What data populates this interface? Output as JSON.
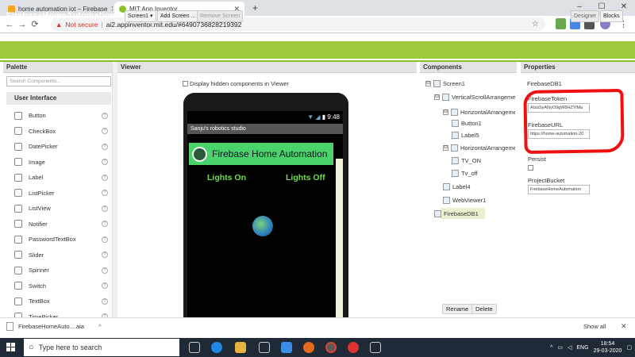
{
  "browser": {
    "tabs": [
      {
        "title": "home automation iot – Firebase",
        "active": false
      },
      {
        "title": "MIT App Inventor",
        "active": true
      }
    ],
    "new_tab": "+",
    "window_controls": {
      "minimize": "–",
      "maximize": "☐",
      "close": "✕"
    },
    "nav": {
      "back": "←",
      "forward": "→",
      "reload": "⟳"
    },
    "address": {
      "security": "Not secure",
      "separator": "|",
      "url": "ai2.appinventor.mit.edu/#6490736828219392"
    }
  },
  "app": {
    "project_name": "FirebaseHomeAutomation_iot",
    "screen_select": "Screen1 ▾",
    "add_screen": "Add Screen ...",
    "remove_screen": "Remove Screen",
    "designer": "Designer",
    "blocks": "Blocks"
  },
  "palette": {
    "header": "Palette",
    "search_placeholder": "Search Components...",
    "group": "User Interface",
    "items": [
      "Button",
      "CheckBox",
      "DatePicker",
      "Image",
      "Label",
      "ListPicker",
      "ListView",
      "Notifier",
      "PasswordTextBox",
      "Slider",
      "Spinner",
      "Switch",
      "TextBox",
      "TimePicker"
    ],
    "help": "?"
  },
  "viewer": {
    "header": "Viewer",
    "hidden_toggle": "Display hidden components in Viewer",
    "phone": {
      "time": "9:48",
      "screen_title": "Sanju's robotics studio",
      "app_title": "Firebase Home Automation",
      "lights_on": "Lights On",
      "lights_off": "Lights Off"
    }
  },
  "components": {
    "header": "Components",
    "tree": [
      {
        "label": "Screen1",
        "level": 0,
        "toggle": "⊟"
      },
      {
        "label": "VerticalScrollArrangemen",
        "level": 1,
        "toggle": "⊟"
      },
      {
        "label": "HorizontalArrangemen",
        "level": 2,
        "toggle": "⊟"
      },
      {
        "label": "Button1",
        "level": 3,
        "toggle": ""
      },
      {
        "label": "Label5",
        "level": 3,
        "toggle": ""
      },
      {
        "label": "HorizontalArrangemen",
        "level": 2,
        "toggle": "⊟"
      },
      {
        "label": "TV_ON",
        "level": 3,
        "toggle": ""
      },
      {
        "label": "Tv_off",
        "level": 3,
        "toggle": ""
      },
      {
        "label": "Label4",
        "level": 2,
        "toggle": ""
      },
      {
        "label": "WebViewer1",
        "level": 2,
        "toggle": ""
      },
      {
        "label": "FirebaseDB1",
        "level": 1,
        "toggle": ""
      }
    ],
    "rename": "Rename",
    "delete": "Delete"
  },
  "properties": {
    "header": "Properties",
    "component": "FirebaseDB1",
    "firebase_token_label": "FirebaseToken",
    "firebase_token_value": "AIzaSyANyO9gW8HZYiMa",
    "firebase_url_label": "FirebaseURL",
    "firebase_url_value": "https://home-automation-20",
    "persist_label": "Persist",
    "project_bucket_label": "ProjectBucket",
    "project_bucket_value": "FirebaseHomeAutomation"
  },
  "downloads": {
    "file": "FirebaseHomeAuto....aia",
    "chevron": "^",
    "show_all": "Show all",
    "close": "✕"
  },
  "taskbar": {
    "search_placeholder": "Type here to search",
    "language": "ENG",
    "time": "18:54",
    "date": "29-03-2020"
  }
}
